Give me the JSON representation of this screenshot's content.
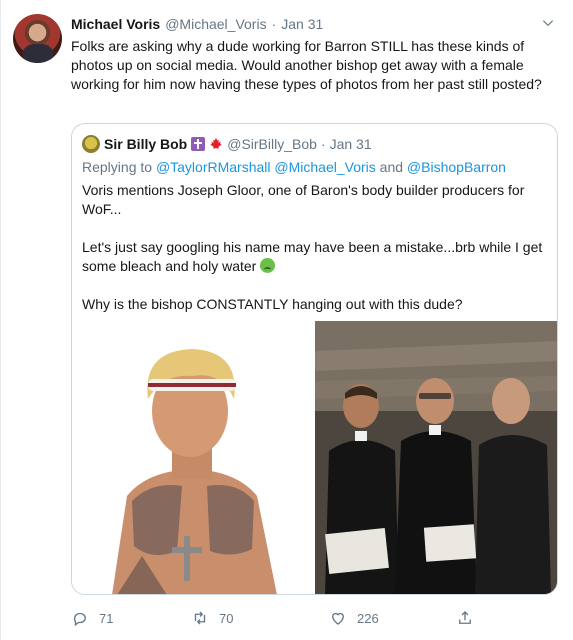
{
  "tweet": {
    "author_name": "Michael Voris",
    "author_handle": "@Michael_Voris",
    "separator": "·",
    "date": "Jan 31",
    "text": "Folks are asking why a dude working for Barron STILL has these kinds of photos up on social media. Would another bishop get away with a female working for him now having these types of photos from her past still posted?"
  },
  "quoted_tweet": {
    "author_name": "Sir Billy Bob",
    "author_handle": "@SirBilly_Bob",
    "separator": "·",
    "date": "Jan 31",
    "replying_prefix": "Replying to",
    "mentions": [
      "@TaylorRMarshall",
      "@Michael_Voris",
      "@BishopBarron"
    ],
    "mentions_joiner": "and",
    "paragraph_1": "Voris mentions Joseph Gloor, one of Baron's body builder producers for WoF...",
    "paragraph_2": "Let's just say googling his name may have been a mistake...brb while I get some bleach and holy water",
    "paragraph_3": "Why is the bishop CONSTANTLY hanging out with this dude?"
  },
  "actions": {
    "reply_count": "71",
    "retweet_count": "70",
    "like_count": "226"
  },
  "colors": {
    "link": "#1b95e0",
    "secondary_text": "#657786",
    "border": "#ccd6dd"
  },
  "icons": [
    "chevron-down-icon",
    "cross-emoji-icon",
    "maple-leaf-icon",
    "nauseated-face-emoji-icon",
    "reply-icon",
    "retweet-icon",
    "like-icon",
    "share-icon"
  ]
}
